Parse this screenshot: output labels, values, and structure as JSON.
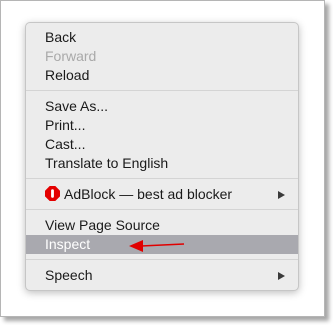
{
  "context_menu": {
    "back_label": "Back",
    "forward_label": "Forward",
    "reload_label": "Reload",
    "save_as_label": "Save As...",
    "print_label": "Print...",
    "cast_label": "Cast...",
    "translate_label": "Translate to English",
    "adblock_label": "AdBlock — best ad blocker",
    "view_source_label": "View Page Source",
    "inspect_label": "Inspect",
    "speech_label": "Speech"
  },
  "icons": {
    "adblock": "adblock-stop-sign-icon",
    "submenu": "chevron-right-icon",
    "annotation": "red-arrow-icon"
  },
  "colors": {
    "menu_bg": "#ececec",
    "selected_bg": "#a9a9af",
    "disabled_text": "#a9a9a9",
    "annotation_red": "#e00000",
    "adblock_red": "#e40000"
  }
}
